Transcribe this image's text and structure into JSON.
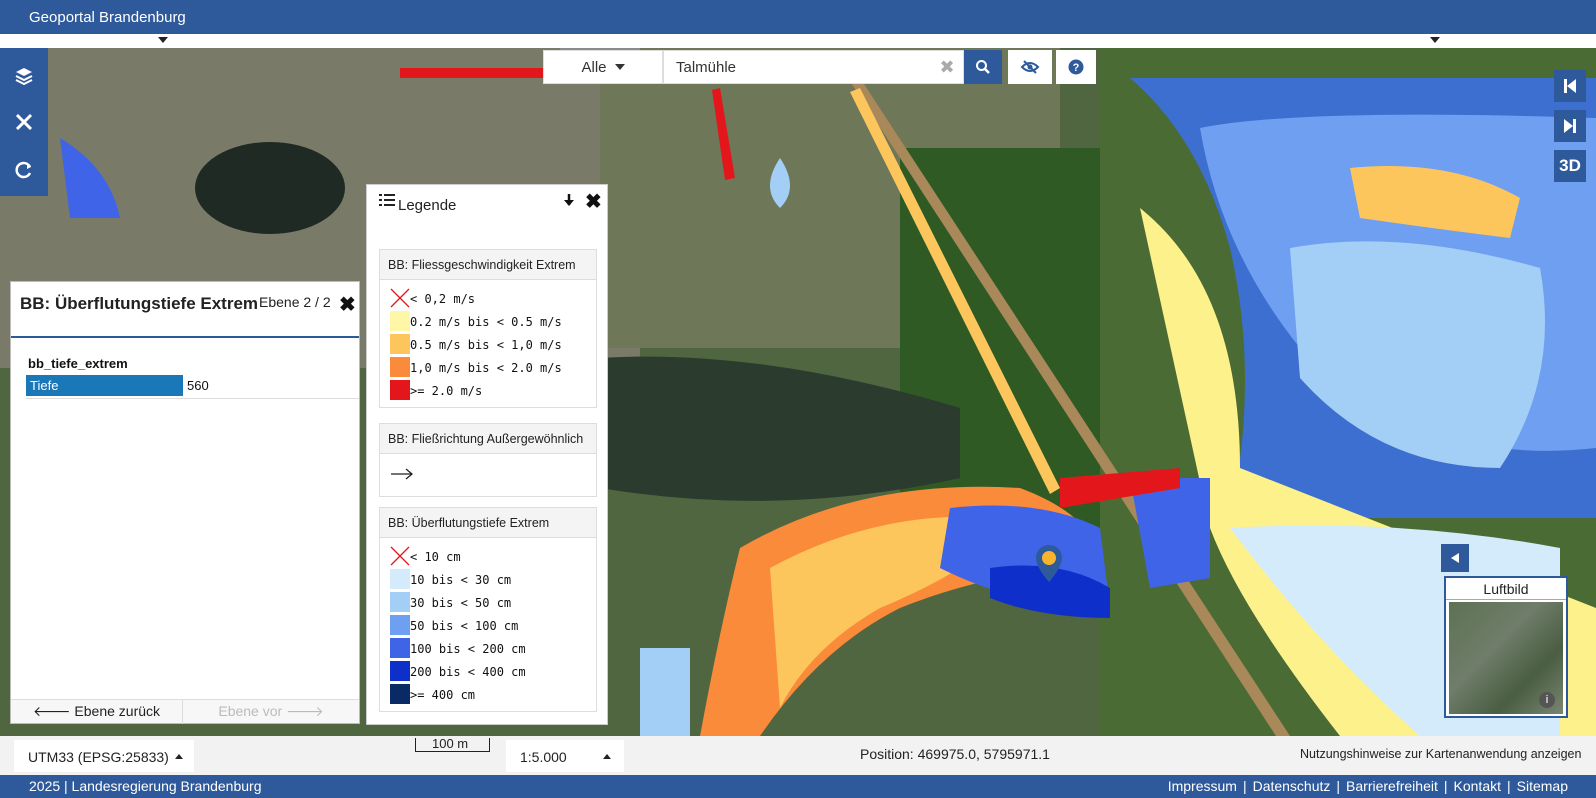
{
  "header": {
    "title": "Geoportal Brandenburg"
  },
  "search": {
    "category": "Alle",
    "value": "Talmühle",
    "clear": "✖"
  },
  "right_nav": {
    "three_d": "3D"
  },
  "legend": {
    "title": "Legende",
    "groups": [
      {
        "title": "BB: Fliessgeschwindigkeit Extrem",
        "items": [
          {
            "label": "< 0,2 m/s",
            "color": "none"
          },
          {
            "label": "0.2 m/s bis < 0.5 m/s",
            "color": "#fff7a8"
          },
          {
            "label": "0.5 m/s bis < 1,0 m/s",
            "color": "#fdc65c"
          },
          {
            "label": "1,0 m/s bis < 2.0 m/s",
            "color": "#f98b3a"
          },
          {
            "label": ">= 2.0 m/s",
            "color": "#e3171b"
          }
        ]
      },
      {
        "title": "BB: Fließrichtung Außergewöhnlich",
        "items": [
          {
            "label": "",
            "color": "arrow"
          }
        ]
      },
      {
        "title": "BB: Überflutungstiefe Extrem",
        "items": [
          {
            "label": "< 10 cm",
            "color": "none"
          },
          {
            "label": "10 bis < 30 cm",
            "color": "#d3ebfb"
          },
          {
            "label": "30 bis < 50 cm",
            "color": "#a3cff7"
          },
          {
            "label": "50 bis < 100 cm",
            "color": "#6f9ff1"
          },
          {
            "label": "100 bis < 200 cm",
            "color": "#3f64e8"
          },
          {
            "label": "200 bis < 400 cm",
            "color": "#0f2fcb"
          },
          {
            "label": ">= 400 cm",
            "color": "#0a2a66"
          }
        ]
      }
    ]
  },
  "info": {
    "title": "BB: Überflutungstiefe Extrem",
    "level": "Ebene 2 / 2",
    "layer_name": "bb_tiefe_extrem",
    "attributes": [
      {
        "key": "Tiefe",
        "value": "560"
      }
    ],
    "back": "Ebene zurück",
    "forward": "Ebene vor"
  },
  "overview": {
    "label": "Luftbild"
  },
  "status": {
    "crs": "UTM33 (EPSG:25833)",
    "scale_bar": "100 m",
    "scale": "1:5.000",
    "position": "Position: 469975.0, 5795971.1",
    "hint": "Nutzungshinweise zur Kartenanwendung anzeigen"
  },
  "footer": {
    "copyright": "2025 | Landesregierung Brandenburg",
    "links": [
      "Impressum",
      "Datenschutz",
      "Barrierefreiheit",
      "Kontakt",
      "Sitemap"
    ]
  }
}
